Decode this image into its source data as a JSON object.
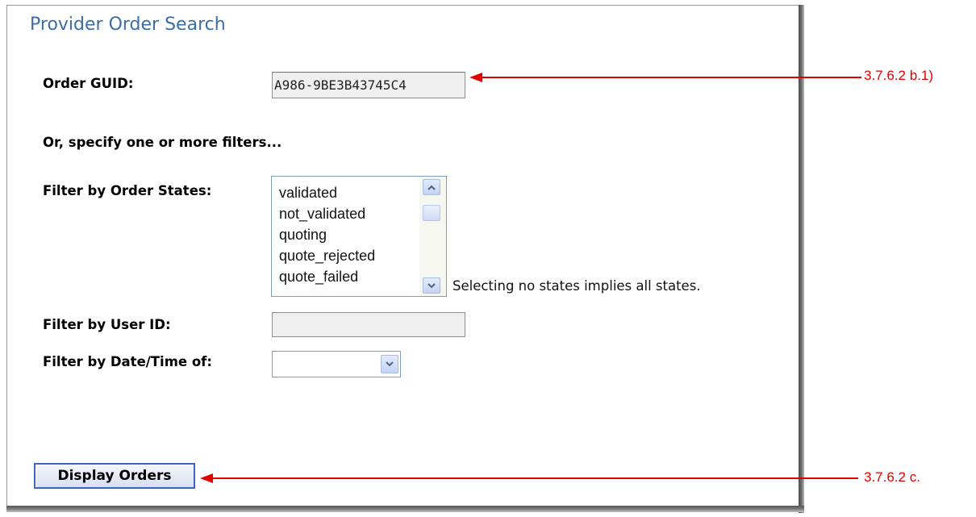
{
  "form": {
    "title": "Provider Order Search",
    "order_guid_label": "Order GUID:",
    "order_guid_value": "A986-9BE3B43745C4",
    "filters_intro": "Or, specify one or more filters...",
    "order_states_label": "Filter by Order States:",
    "order_states_options": [
      "validated",
      "not_validated",
      "quoting",
      "quote_rejected",
      "quote_failed"
    ],
    "order_states_hint": "Selecting no states implies all states.",
    "user_id_label": "Filter by User ID:",
    "user_id_value": "",
    "datetime_label": "Filter by Date/Time of:",
    "datetime_selected": "",
    "display_button_label": "Display Orders"
  },
  "annotations": {
    "guid_ref": "3.7.6.2 b.1)",
    "button_ref": "3.7.6.2 c.",
    "color": "#e00000"
  },
  "colors": {
    "title": "#3a6ea5",
    "button_border": "#3c64c8"
  }
}
